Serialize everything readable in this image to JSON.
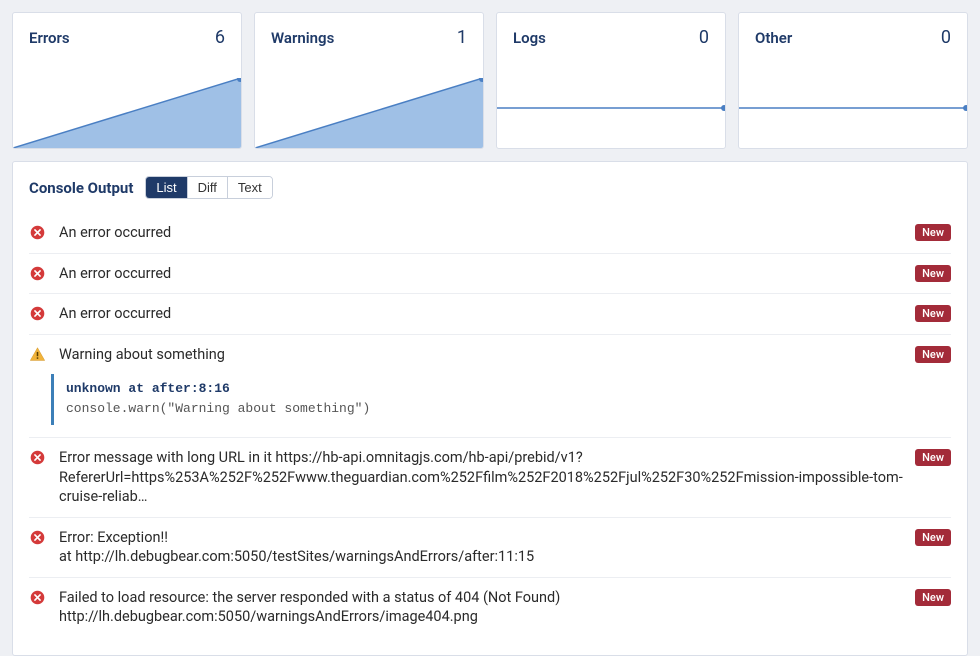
{
  "cards": [
    {
      "title": "Errors",
      "count": "6"
    },
    {
      "title": "Warnings",
      "count": "1"
    },
    {
      "title": "Logs",
      "count": "0"
    },
    {
      "title": "Other",
      "count": "0"
    }
  ],
  "chart_data": [
    {
      "type": "area",
      "title": "Errors",
      "x": [
        0,
        1
      ],
      "values": [
        0,
        6
      ],
      "ylim": [
        0,
        6
      ]
    },
    {
      "type": "area",
      "title": "Warnings",
      "x": [
        0,
        1
      ],
      "values": [
        0,
        1
      ],
      "ylim": [
        0,
        1
      ]
    },
    {
      "type": "line",
      "title": "Logs",
      "x": [
        0,
        1
      ],
      "values": [
        0,
        0
      ],
      "ylim": [
        0,
        1
      ]
    },
    {
      "type": "line",
      "title": "Other",
      "x": [
        0,
        1
      ],
      "values": [
        0,
        0
      ],
      "ylim": [
        0,
        1
      ]
    }
  ],
  "panel": {
    "title": "Console Output",
    "view_tabs": {
      "list": "List",
      "diff": "Diff",
      "text": "Text"
    }
  },
  "rows": [
    {
      "msg": "An error occurred",
      "badge": "New"
    },
    {
      "msg": "An error occurred",
      "badge": "New"
    },
    {
      "msg": "An error occurred",
      "badge": "New"
    },
    {
      "msg": "Warning about something",
      "badge": "New",
      "detail_loc": "unknown at after:8:16",
      "detail_code": "console.warn(\"Warning about something\")"
    },
    {
      "msg": "Error message with long URL in it https://hb-api.omnitagjs.com/hb-api/prebid/v1?RefererUrl=https%253A%252F%252Fwww.theguardian.com%252Ffilm%252F2018%252Fjul%252F30%252Fmission-impossible-tom-cruise-reliab…",
      "badge": "New"
    },
    {
      "msg": "Error: Exception!!\nat http://lh.debugbear.com:5050/testSites/warningsAndErrors/after:11:15",
      "badge": "New"
    },
    {
      "msg": "Failed to load resource: the server responded with a status of 404 (Not Found) http://lh.debugbear.com:5050/warningsAndErrors/image404.png",
      "badge": "New"
    }
  ]
}
